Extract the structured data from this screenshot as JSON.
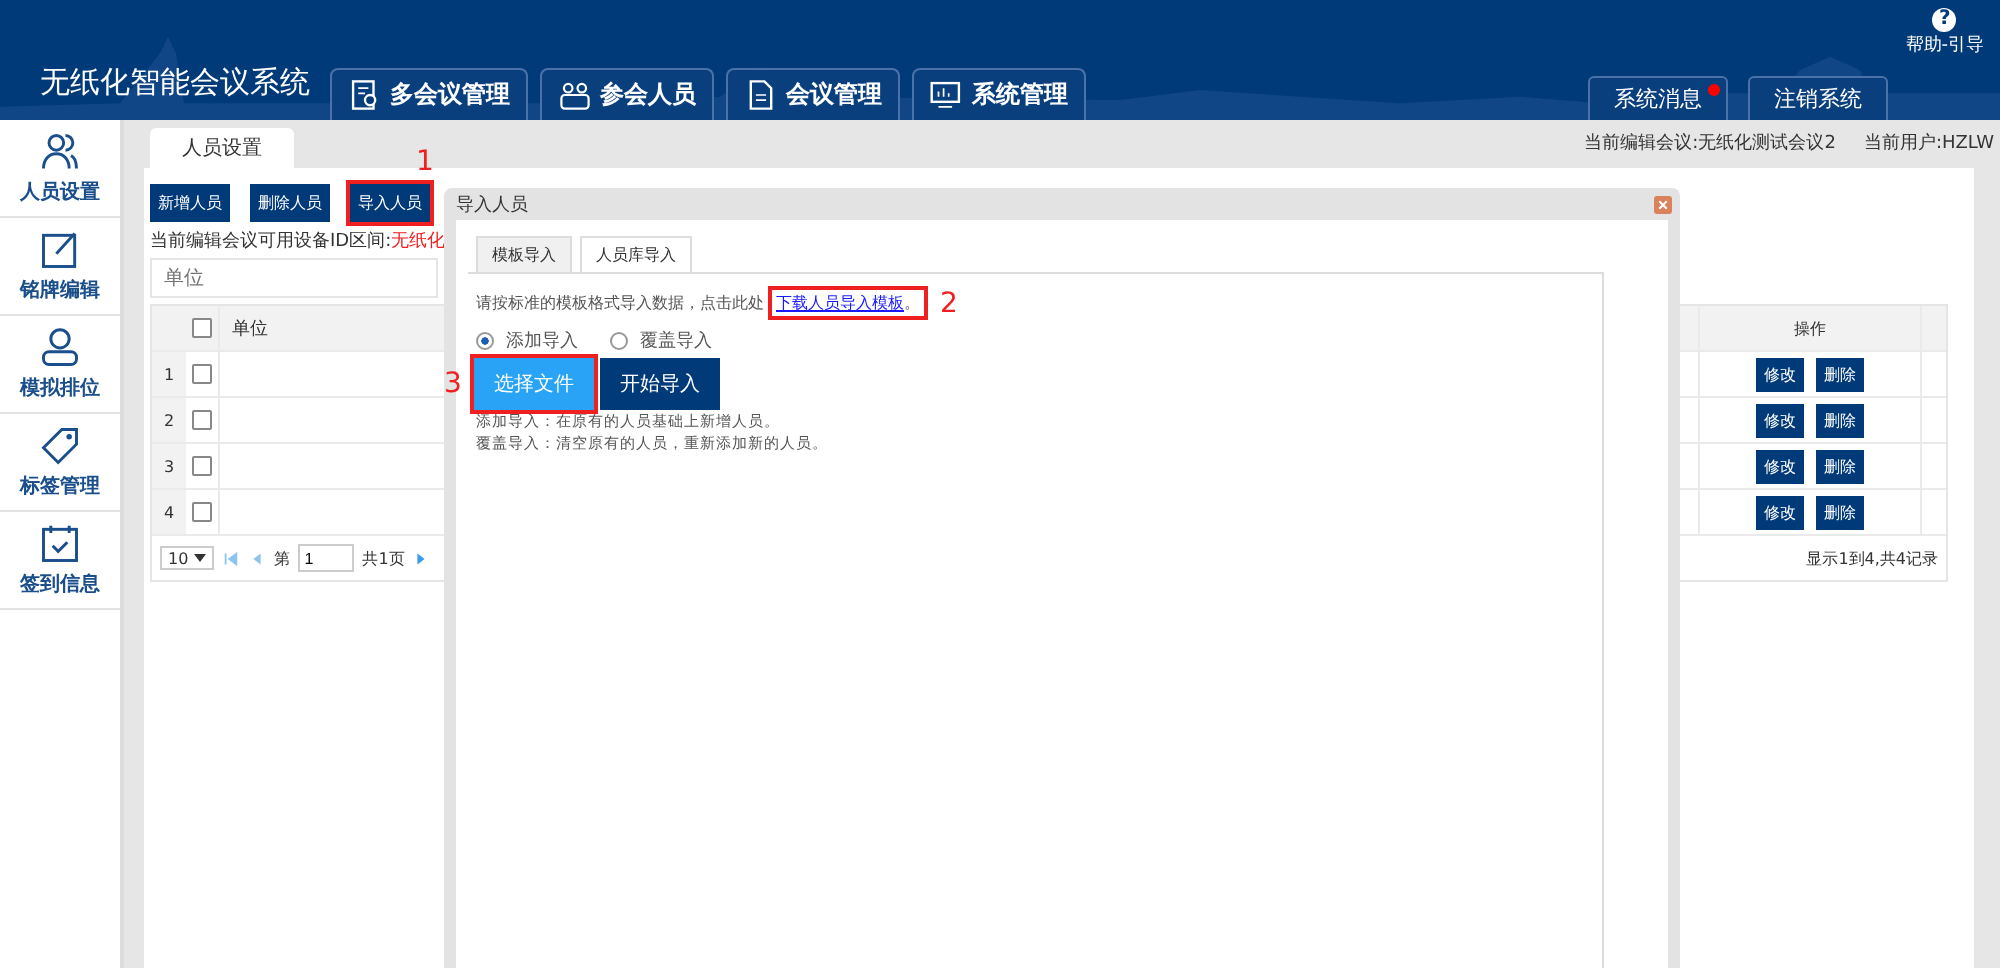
{
  "header": {
    "title": "无纸化智能会议系统",
    "nav": [
      {
        "label": "多会议管理"
      },
      {
        "label": "参会人员"
      },
      {
        "label": "会议管理"
      },
      {
        "label": "系统管理"
      }
    ],
    "help_glyph": "?",
    "help": "帮助-引导",
    "links": [
      {
        "label": "系统消息",
        "unread": true
      },
      {
        "label": "注销系统",
        "unread": false
      }
    ]
  },
  "sidebar": [
    {
      "label": "人员设置"
    },
    {
      "label": "铭牌编辑"
    },
    {
      "label": "模拟排位"
    },
    {
      "label": "标签管理"
    },
    {
      "label": "签到信息"
    }
  ],
  "page_tab": "人员设置",
  "meeting": "当前编辑会议:无纸化测试会议2",
  "user": "当前用户:HZLW",
  "toolbar": [
    {
      "label": "新增人员",
      "highlighted": false
    },
    {
      "label": "删除人员",
      "highlighted": false
    },
    {
      "label": "导入人员",
      "highlighted": true,
      "annotation": "1"
    }
  ],
  "device_range": {
    "label": "当前编辑会议可用设备ID区间:",
    "value": "无纸化"
  },
  "search": {
    "placeholder": "单位"
  },
  "table": {
    "columns": [
      "单位",
      "操作"
    ],
    "header_checked": false,
    "rows": [
      {
        "index": "1",
        "checked": false,
        "actions": [
          "修改",
          "删除"
        ]
      },
      {
        "index": "2",
        "checked": false,
        "actions": [
          "修改",
          "删除"
        ]
      },
      {
        "index": "3",
        "checked": false,
        "actions": [
          "修改",
          "删除"
        ]
      },
      {
        "index": "4",
        "checked": false,
        "actions": [
          "修改",
          "删除"
        ]
      }
    ],
    "pager": {
      "page_size": "10",
      "page_prefix": "第",
      "page": "1",
      "page_suffix": "共1页",
      "summary": "显示1到4,共4记录"
    }
  },
  "dialog": {
    "title": "导入人员",
    "tabs": [
      {
        "label": "模板导入",
        "selected": true
      },
      {
        "label": "人员库导入",
        "selected": false
      }
    ],
    "instruction": "请按标准的模板格式导入数据，点击此处",
    "link": "下载人员导入模板",
    "link_end": "。",
    "link_annotation": "2",
    "modes": [
      {
        "label": "添加导入",
        "selected": true
      },
      {
        "label": "覆盖导入",
        "selected": false
      }
    ],
    "buttons": [
      {
        "label": "选择文件",
        "kind": "primary",
        "highlighted": true,
        "annotation": "3"
      },
      {
        "label": "开始导入",
        "kind": "dark",
        "highlighted": false
      }
    ],
    "notes": [
      "添加导入：在原有的人员基础上新增人员。",
      "覆盖导入：清空原有的人员，重新添加新的人员。"
    ]
  }
}
